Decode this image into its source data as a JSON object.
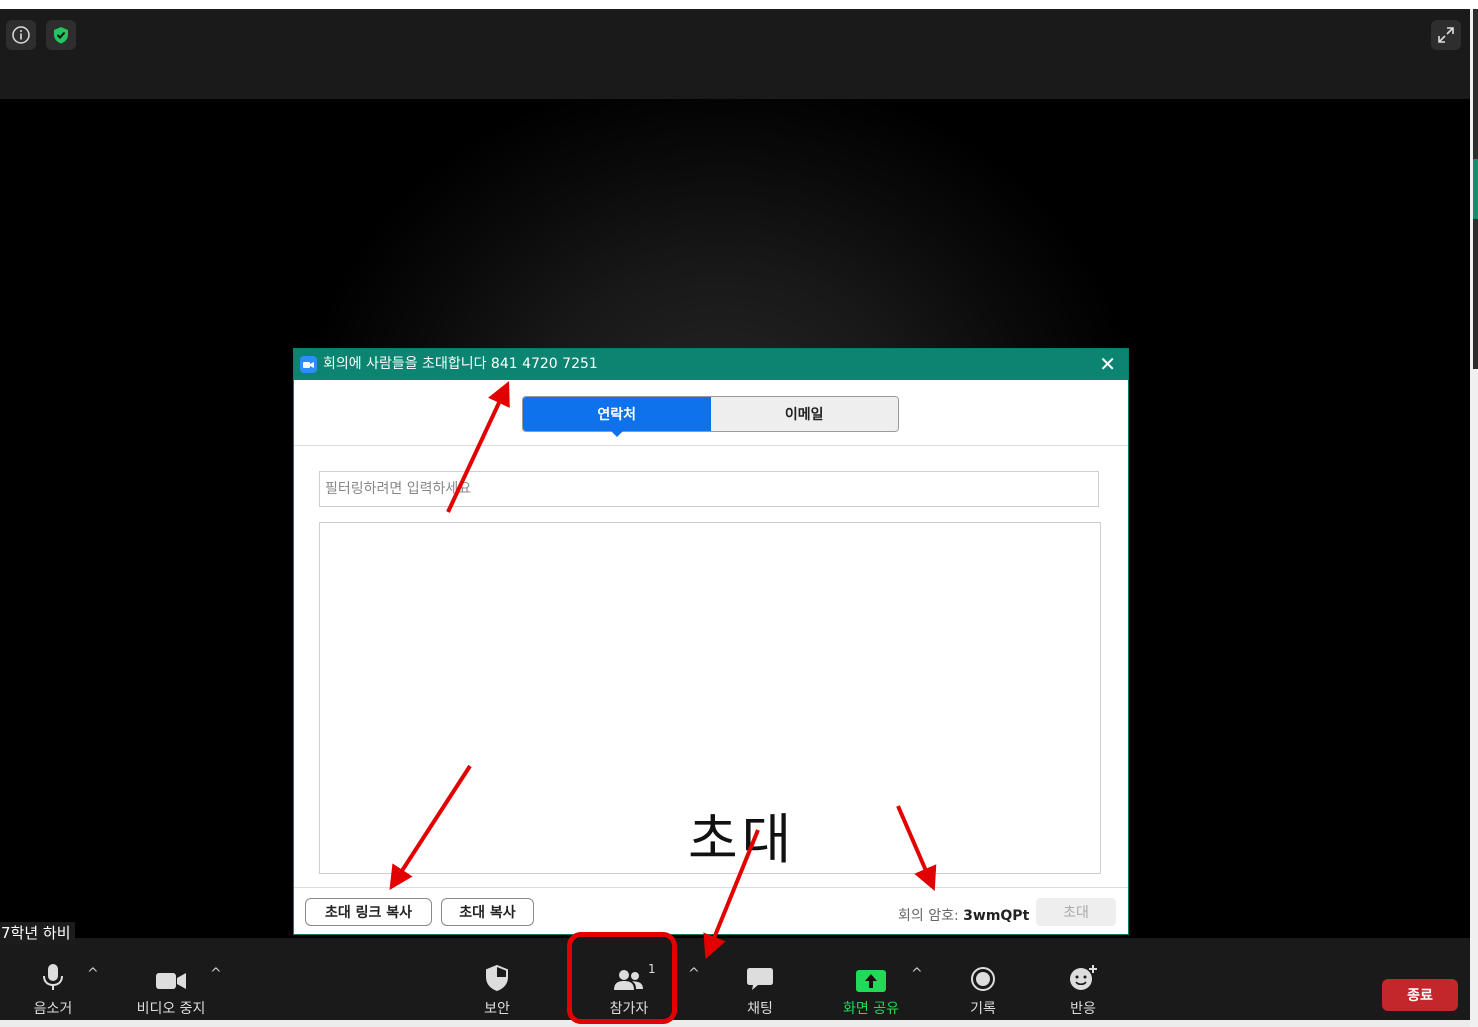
{
  "dialog": {
    "title": "회의에 사람들을 초대합니다 841 4720 7251",
    "close_label": "✕",
    "tabs": [
      {
        "label": "연락처",
        "active": true
      },
      {
        "label": "이메일",
        "active": false
      }
    ],
    "filter_placeholder": "필터링하려면 입력하세요",
    "copy_link_label": "초대 링크 복사",
    "copy_invite_label": "초대 복사",
    "password_label": "회의 암호: ",
    "password_value": "3wmQPt",
    "invite_label": "초대"
  },
  "participant_name": "7학년 하비",
  "toolbar": {
    "mute_label": "음소거",
    "video_label": "비디오 중지",
    "security_label": "보안",
    "participants_label": "참가자",
    "participants_count": "1",
    "chat_label": "채팅",
    "share_label": "화면 공유",
    "record_label": "기록",
    "reactions_label": "반응",
    "end_label": "종료",
    "caret": "^"
  },
  "annotation_text": "초대",
  "colors": {
    "title_bar": "#0b8571",
    "tab_active": "#0e72ed",
    "share_green": "#23d959",
    "end_red": "#c3272b",
    "annotation_red": "#e20000",
    "shield_green": "#22c55e"
  }
}
